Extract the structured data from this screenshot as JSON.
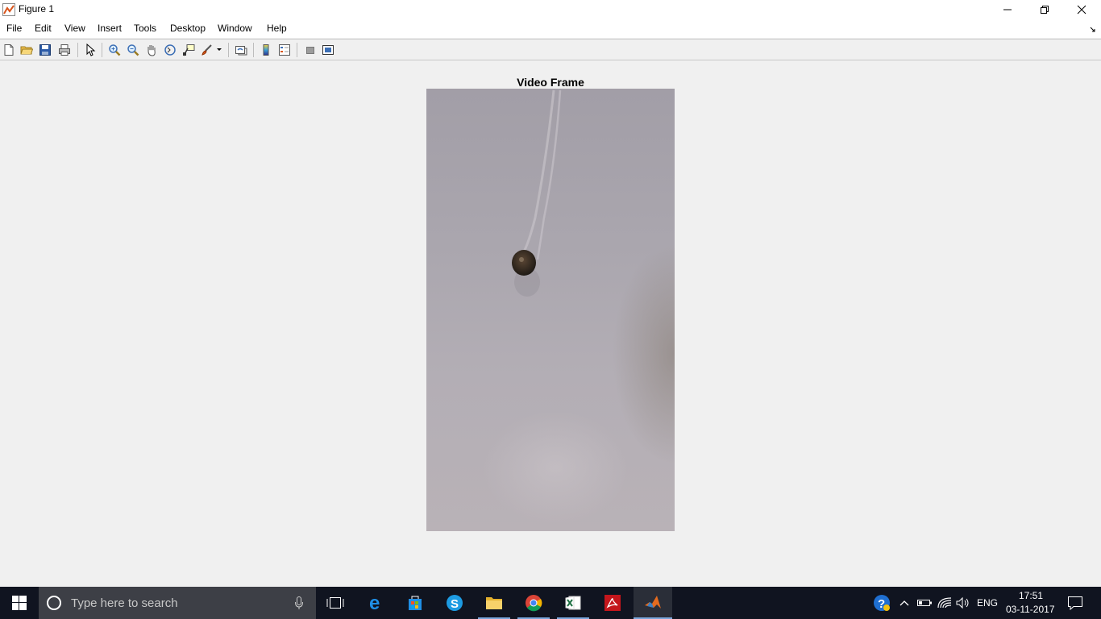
{
  "window": {
    "title": "Figure 1",
    "controls": [
      "minimize-icon",
      "restore-icon",
      "close-icon"
    ]
  },
  "menu": {
    "items": [
      "File",
      "Edit",
      "View",
      "Insert",
      "Tools",
      "Desktop",
      "Window",
      "Help"
    ]
  },
  "toolbar": {
    "buttons": [
      "new-figure-icon",
      "open-file-icon",
      "save-icon",
      "print-icon",
      "edit-plot-icon",
      "zoom-in-icon",
      "zoom-out-icon",
      "pan-icon",
      "rotate-3d-icon",
      "data-cursor-icon",
      "brush-icon",
      "link-plot-icon",
      "insert-colorbar-icon",
      "insert-legend-icon",
      "hide-plot-tools-icon",
      "show-plot-tools-icon"
    ]
  },
  "figure": {
    "axes_title": "Video Frame"
  },
  "taskbar": {
    "search_placeholder": "Type here to search",
    "apps": [
      "start-icon",
      "cortana-icon",
      "microphone-icon",
      "task-view-icon",
      "edge-icon",
      "store-icon",
      "skype-icon",
      "file-explorer-icon",
      "chrome-icon",
      "excel-icon",
      "acrobat-icon",
      "matlab-icon"
    ],
    "tray": {
      "language": "ENG",
      "time": "17:51",
      "date": "03-11-2017"
    }
  },
  "colors": {
    "taskbar": "#101420",
    "search_box": "#3d3f46",
    "window_bg": "#f0f0f0",
    "active_app": "#e46b1f"
  }
}
